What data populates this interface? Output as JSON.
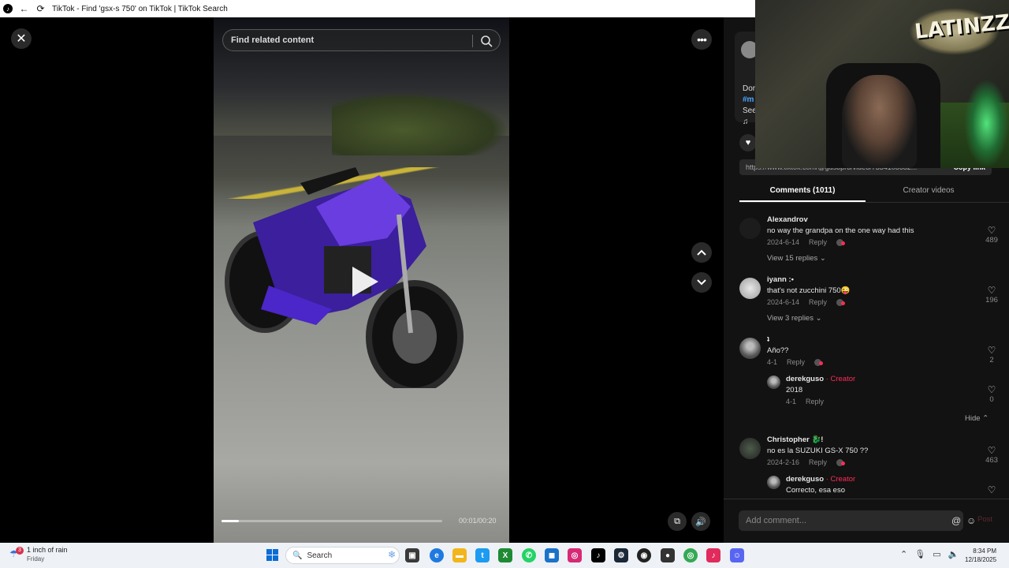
{
  "window": {
    "title": "TikTok - Find 'gsx-s 750' on TikTok | TikTok Search"
  },
  "video": {
    "search_placeholder": "Find related content",
    "timecode": "00:01/00:20",
    "progress_fraction": 0.08
  },
  "author_card": {
    "desc_line1": "Dor",
    "hashtag": "#m",
    "see_more": "See",
    "music_icon": "music-note-icon"
  },
  "link_bar": {
    "url": "https://www.tiktok.com/@gusopro/video/7334108682...",
    "copy_label": "Copy link"
  },
  "tabs": {
    "comments": "Comments (1011)",
    "creator_videos": "Creator videos"
  },
  "comments": [
    {
      "name": "Alexandrov",
      "text": "no way the grandpa on the one way had this",
      "date": "2024-6-14",
      "reply": "Reply",
      "likes": "489",
      "replies_label": "View 15 replies"
    },
    {
      "name": "iyann :•",
      "text": "that's not zucchini 750😜",
      "date": "2024-6-14",
      "reply": "Reply",
      "likes": "196",
      "replies_label": "View 3 replies"
    },
    {
      "name": "ʇ",
      "text": "Año??",
      "date": "4-1",
      "reply": "Reply",
      "likes": "2"
    },
    {
      "name": "Christopher 🐉!",
      "text": "no es la SUZUKI GS-X 750 ??",
      "date": "2024-2-16",
      "reply": "Reply",
      "likes": "463"
    }
  ],
  "subcomments": [
    {
      "name": "derekguso",
      "creator_tag": "· Creator",
      "text": "2018",
      "date": "4-1",
      "reply": "Reply",
      "likes": "0"
    },
    {
      "name": "derekguso",
      "creator_tag": "· Creator",
      "text": "Correcto, esa eso"
    }
  ],
  "hide_label": "Hide",
  "add_comment": {
    "placeholder": "Add comment...",
    "post_label": "Post"
  },
  "webcam": {
    "overlay_text": "LATINZZZ!"
  },
  "taskbar": {
    "weather_title": "1 inch of rain",
    "weather_sub": "Friday",
    "weather_badge": "3",
    "search_label": "Search",
    "time": "8:34 PM",
    "date": "12/18/2025"
  }
}
